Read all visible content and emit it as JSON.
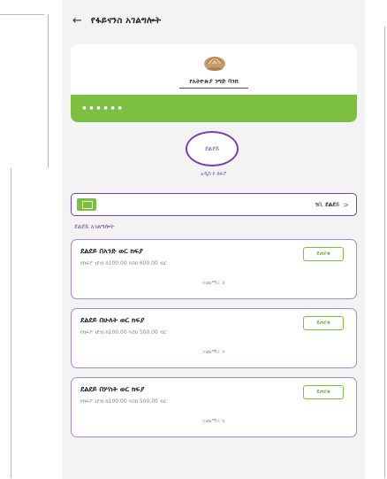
{
  "header": {
    "back_icon": "←",
    "title": "የፋይናንስ አገልግሎት"
  },
  "profile": {
    "avatar_icon": "seashell-avatar-icon",
    "name": "የአትዮጵያ ንግድ ባንክ",
    "account_mask": "••••••",
    "accent_green": "#7dc041"
  },
  "transaction": {
    "circle_label": "ደልደይ",
    "caption": "አዲስ የ ክፍያ"
  },
  "savings": {
    "icon": "safe-box-icon",
    "label": "ገቢ ደልደይ",
    "chevron": ">"
  },
  "section_title": "ደልደይ አገልግሎት",
  "plans": [
    {
      "title": "ደልደይ በአንድ ወር ክፍያ",
      "desc": "የክፍያ ገደብ ከ100.00 እስከ 600.00 ብር",
      "button": "ይጠየቁ",
      "more": "ተጨማሪ ∨"
    },
    {
      "title": "ደልደይ በሁለት ወር ክፍያ",
      "desc": "የክፍያ ገደብ ከ100.00 እስከ 500.00 ብር",
      "button": "ይጠየቁ",
      "more": "ተጨማሪ ∨"
    },
    {
      "title": "ደልደይ በሦስት ወር ክፍያ",
      "desc": "የክፍያ ገደብ ከ100.00 እስከ 500.00 ብር",
      "button": "ይጠየቁ",
      "more": "ተጨማሪ ∨"
    }
  ],
  "colors": {
    "purple": "#7a3fb0",
    "green": "#7dc041"
  }
}
